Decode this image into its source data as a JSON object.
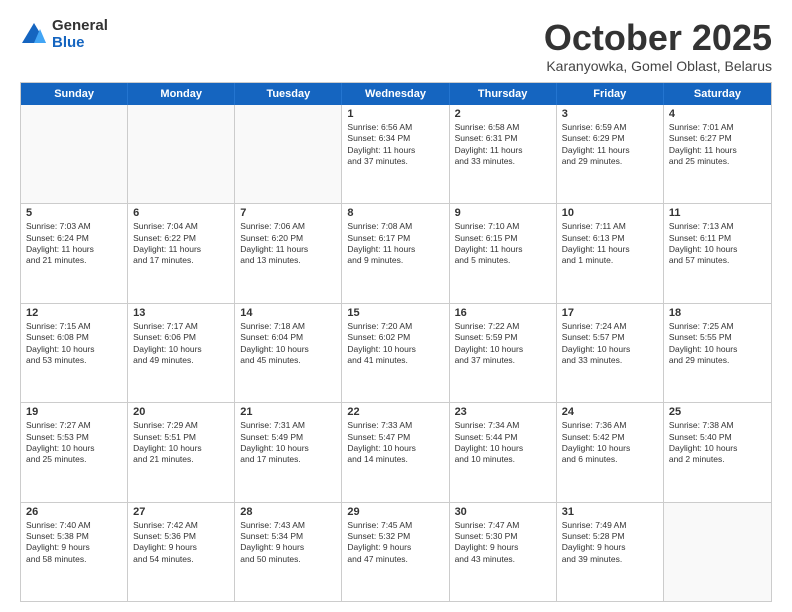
{
  "logo": {
    "general": "General",
    "blue": "Blue"
  },
  "title": "October 2025",
  "subtitle": "Karanyowka, Gomel Oblast, Belarus",
  "header_days": [
    "Sunday",
    "Monday",
    "Tuesday",
    "Wednesday",
    "Thursday",
    "Friday",
    "Saturday"
  ],
  "weeks": [
    [
      {
        "day": "",
        "text": ""
      },
      {
        "day": "",
        "text": ""
      },
      {
        "day": "",
        "text": ""
      },
      {
        "day": "1",
        "text": "Sunrise: 6:56 AM\nSunset: 6:34 PM\nDaylight: 11 hours\nand 37 minutes."
      },
      {
        "day": "2",
        "text": "Sunrise: 6:58 AM\nSunset: 6:31 PM\nDaylight: 11 hours\nand 33 minutes."
      },
      {
        "day": "3",
        "text": "Sunrise: 6:59 AM\nSunset: 6:29 PM\nDaylight: 11 hours\nand 29 minutes."
      },
      {
        "day": "4",
        "text": "Sunrise: 7:01 AM\nSunset: 6:27 PM\nDaylight: 11 hours\nand 25 minutes."
      }
    ],
    [
      {
        "day": "5",
        "text": "Sunrise: 7:03 AM\nSunset: 6:24 PM\nDaylight: 11 hours\nand 21 minutes."
      },
      {
        "day": "6",
        "text": "Sunrise: 7:04 AM\nSunset: 6:22 PM\nDaylight: 11 hours\nand 17 minutes."
      },
      {
        "day": "7",
        "text": "Sunrise: 7:06 AM\nSunset: 6:20 PM\nDaylight: 11 hours\nand 13 minutes."
      },
      {
        "day": "8",
        "text": "Sunrise: 7:08 AM\nSunset: 6:17 PM\nDaylight: 11 hours\nand 9 minutes."
      },
      {
        "day": "9",
        "text": "Sunrise: 7:10 AM\nSunset: 6:15 PM\nDaylight: 11 hours\nand 5 minutes."
      },
      {
        "day": "10",
        "text": "Sunrise: 7:11 AM\nSunset: 6:13 PM\nDaylight: 11 hours\nand 1 minute."
      },
      {
        "day": "11",
        "text": "Sunrise: 7:13 AM\nSunset: 6:11 PM\nDaylight: 10 hours\nand 57 minutes."
      }
    ],
    [
      {
        "day": "12",
        "text": "Sunrise: 7:15 AM\nSunset: 6:08 PM\nDaylight: 10 hours\nand 53 minutes."
      },
      {
        "day": "13",
        "text": "Sunrise: 7:17 AM\nSunset: 6:06 PM\nDaylight: 10 hours\nand 49 minutes."
      },
      {
        "day": "14",
        "text": "Sunrise: 7:18 AM\nSunset: 6:04 PM\nDaylight: 10 hours\nand 45 minutes."
      },
      {
        "day": "15",
        "text": "Sunrise: 7:20 AM\nSunset: 6:02 PM\nDaylight: 10 hours\nand 41 minutes."
      },
      {
        "day": "16",
        "text": "Sunrise: 7:22 AM\nSunset: 5:59 PM\nDaylight: 10 hours\nand 37 minutes."
      },
      {
        "day": "17",
        "text": "Sunrise: 7:24 AM\nSunset: 5:57 PM\nDaylight: 10 hours\nand 33 minutes."
      },
      {
        "day": "18",
        "text": "Sunrise: 7:25 AM\nSunset: 5:55 PM\nDaylight: 10 hours\nand 29 minutes."
      }
    ],
    [
      {
        "day": "19",
        "text": "Sunrise: 7:27 AM\nSunset: 5:53 PM\nDaylight: 10 hours\nand 25 minutes."
      },
      {
        "day": "20",
        "text": "Sunrise: 7:29 AM\nSunset: 5:51 PM\nDaylight: 10 hours\nand 21 minutes."
      },
      {
        "day": "21",
        "text": "Sunrise: 7:31 AM\nSunset: 5:49 PM\nDaylight: 10 hours\nand 17 minutes."
      },
      {
        "day": "22",
        "text": "Sunrise: 7:33 AM\nSunset: 5:47 PM\nDaylight: 10 hours\nand 14 minutes."
      },
      {
        "day": "23",
        "text": "Sunrise: 7:34 AM\nSunset: 5:44 PM\nDaylight: 10 hours\nand 10 minutes."
      },
      {
        "day": "24",
        "text": "Sunrise: 7:36 AM\nSunset: 5:42 PM\nDaylight: 10 hours\nand 6 minutes."
      },
      {
        "day": "25",
        "text": "Sunrise: 7:38 AM\nSunset: 5:40 PM\nDaylight: 10 hours\nand 2 minutes."
      }
    ],
    [
      {
        "day": "26",
        "text": "Sunrise: 7:40 AM\nSunset: 5:38 PM\nDaylight: 9 hours\nand 58 minutes."
      },
      {
        "day": "27",
        "text": "Sunrise: 7:42 AM\nSunset: 5:36 PM\nDaylight: 9 hours\nand 54 minutes."
      },
      {
        "day": "28",
        "text": "Sunrise: 7:43 AM\nSunset: 5:34 PM\nDaylight: 9 hours\nand 50 minutes."
      },
      {
        "day": "29",
        "text": "Sunrise: 7:45 AM\nSunset: 5:32 PM\nDaylight: 9 hours\nand 47 minutes."
      },
      {
        "day": "30",
        "text": "Sunrise: 7:47 AM\nSunset: 5:30 PM\nDaylight: 9 hours\nand 43 minutes."
      },
      {
        "day": "31",
        "text": "Sunrise: 7:49 AM\nSunset: 5:28 PM\nDaylight: 9 hours\nand 39 minutes."
      },
      {
        "day": "",
        "text": ""
      }
    ]
  ]
}
